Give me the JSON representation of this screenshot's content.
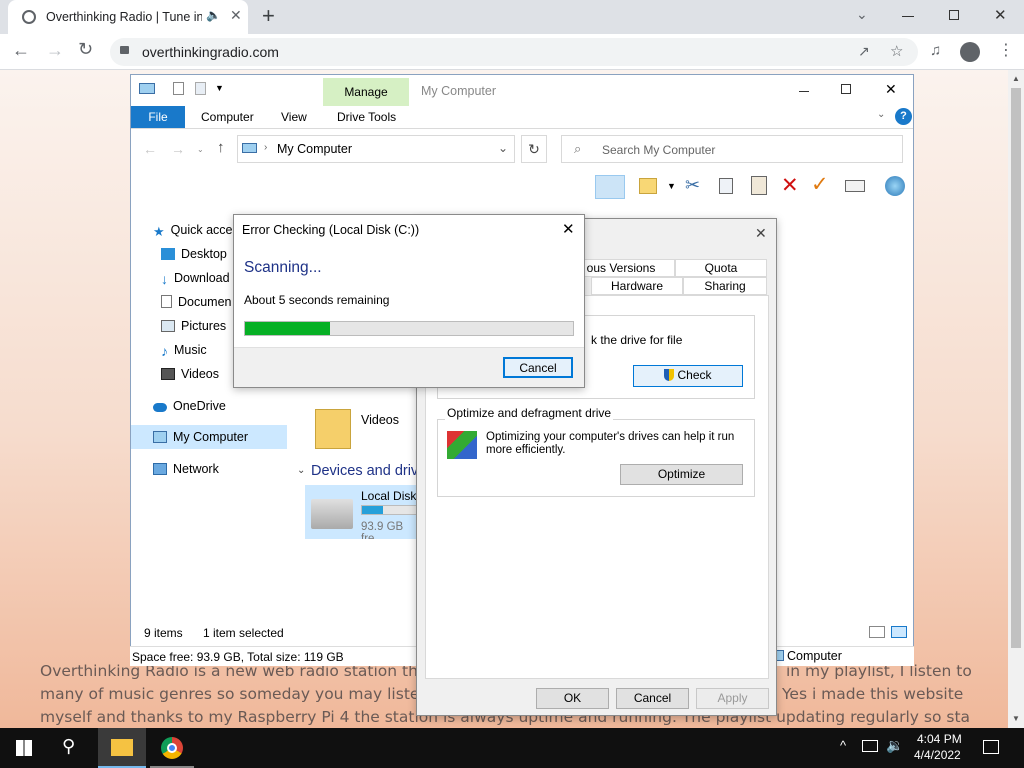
{
  "browser": {
    "tab_title": "Overthinking Radio | Tune in",
    "url": "overthinkingradio.com"
  },
  "website": {
    "lines": [
      "Overthinking Radio is a new web radio station tha",
      "in my playlist, I listen to",
      "many of music genres so someday you may listen",
      "Yes i made this website",
      "myself and thanks to my Raspberry Pi 4 the station is always uptime and running. The playlist updating regularly so stay"
    ]
  },
  "explorer": {
    "manage_tab": "Manage",
    "window_title": "My Computer",
    "ribbon_tabs": [
      "File",
      "Computer",
      "View",
      "Drive Tools"
    ],
    "breadcrumb": "My Computer",
    "search_placeholder": "Search My Computer",
    "nav": {
      "quick_access": "Quick acce",
      "desktop": "Desktop",
      "downloads": "Download",
      "documents": "Documen",
      "pictures": "Pictures",
      "music": "Music",
      "videos": "Videos",
      "onedrive": "OneDrive",
      "mycomputer": "My Computer",
      "network": "Network"
    },
    "videos_folder": "Videos",
    "devices_header": "Devices and driv",
    "drive_name": "Local Disk",
    "drive_free": "93.9 GB fre",
    "drive_used_fraction": 0.21,
    "status_items": "9 items",
    "status_selected": "1 item selected",
    "bottom_status": "Space free: 93.9 GB, Total size: 119 GB",
    "bottom_computer": "Computer"
  },
  "properties": {
    "tabs_row1": [
      "ous Versions",
      "Quota"
    ],
    "tabs_row2": [
      "Hardware",
      "Sharing"
    ],
    "check_text": "k the drive for file",
    "check_button": "Check",
    "optimize_group": "Optimize and defragment drive",
    "optimize_desc_1": "Optimizing your computer's drives can help it run",
    "optimize_desc_2": "more efficiently.",
    "optimize_button": "Optimize",
    "ok": "OK",
    "cancel": "Cancel",
    "apply": "Apply"
  },
  "error_dialog": {
    "title": "Error Checking (Local Disk (C:))",
    "scanning": "Scanning...",
    "remaining": "About 5 seconds remaining",
    "progress": 0.26,
    "cancel": "Cancel"
  },
  "taskbar": {
    "time": "4:04 PM",
    "date": "4/4/2022"
  },
  "colors": {
    "accent": "#0078d7",
    "progress": "#06b025",
    "manage": "#d6f0c4"
  }
}
